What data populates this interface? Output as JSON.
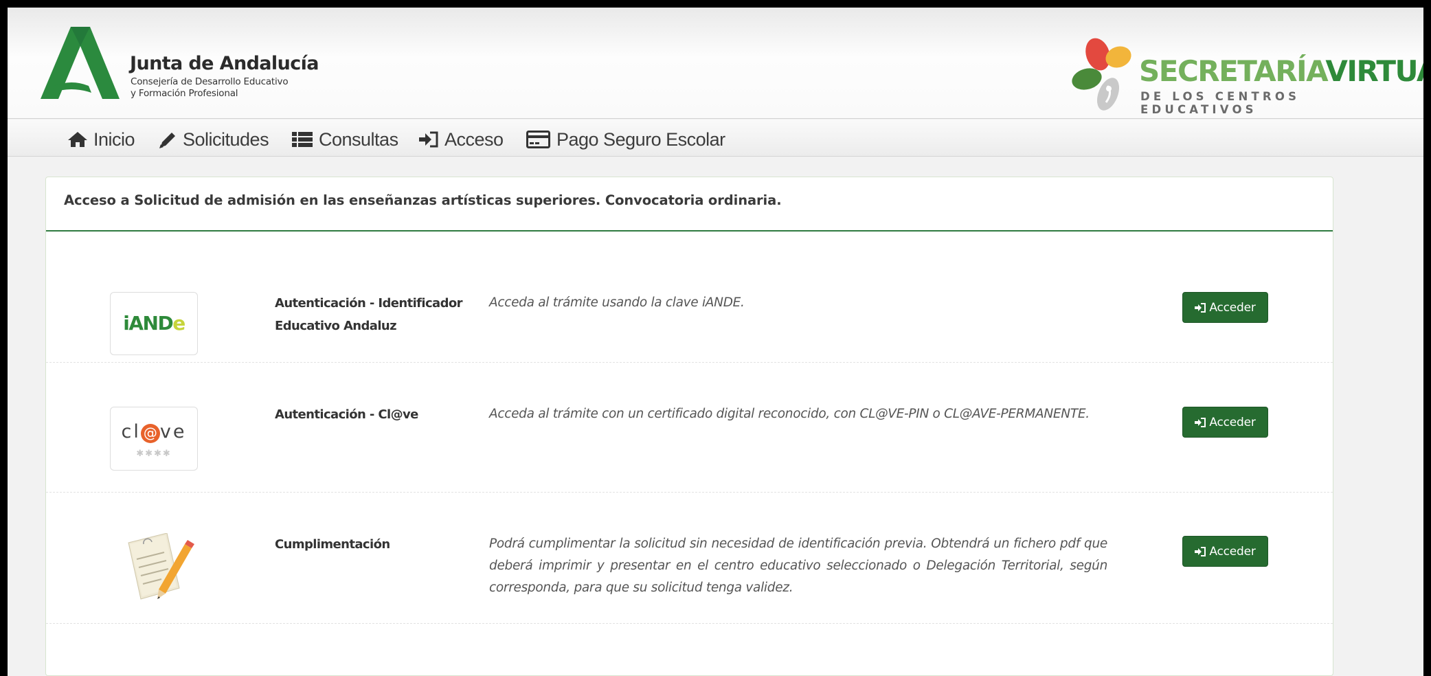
{
  "header": {
    "brand_title": "Junta de Andalucía",
    "brand_subtitle_line1": "Consejería de Desarrollo Educativo",
    "brand_subtitle_line2": "y Formación Profesional",
    "app_title_part1": "SECRETARÍA",
    "app_title_part2": "VIRTUAL",
    "app_subtitle": "DE LOS CENTROS EDUCATIVOS"
  },
  "nav": {
    "items": [
      {
        "label": "Inicio",
        "icon": "home-icon"
      },
      {
        "label": "Solicitudes",
        "icon": "pencil-icon"
      },
      {
        "label": "Consultas",
        "icon": "list-icon"
      },
      {
        "label": "Acceso",
        "icon": "sign-in-icon"
      },
      {
        "label": "Pago Seguro Escolar",
        "icon": "credit-card-icon"
      }
    ]
  },
  "panel": {
    "title": "Acceso a Solicitud de admisión en las enseñanzas artísticas superiores. Convocatoria ordinaria."
  },
  "methods": [
    {
      "logo_text": "iANDe",
      "name": "Autenticación - Identificador Educativo Andaluz",
      "description": "Acceda al trámite usando la clave iANDE.",
      "button_label": "Acceder"
    },
    {
      "logo_text": "cl@ve",
      "logo_stars": "✱✱✱✱",
      "name": "Autenticación - Cl@ve",
      "description": "Acceda al trámite con un certificado digital reconocido, con CL@VE-PIN o CL@AVE-PERMANENTE.",
      "button_label": "Acceder"
    },
    {
      "logo_text": "",
      "name": "Cumplimentación",
      "description": "Podrá cumplimentar la solicitud sin necesidad de identificación previa. Obtendrá un fichero pdf que deberá imprimir y presentar en el centro educativo seleccionado o Delegación Territorial, según corresponda, para que su solicitud tenga validez.",
      "button_label": "Acceder"
    }
  ],
  "colors": {
    "brand_green": "#266b30",
    "header_green": "#2e8a3a",
    "light_green": "#74b05c"
  }
}
